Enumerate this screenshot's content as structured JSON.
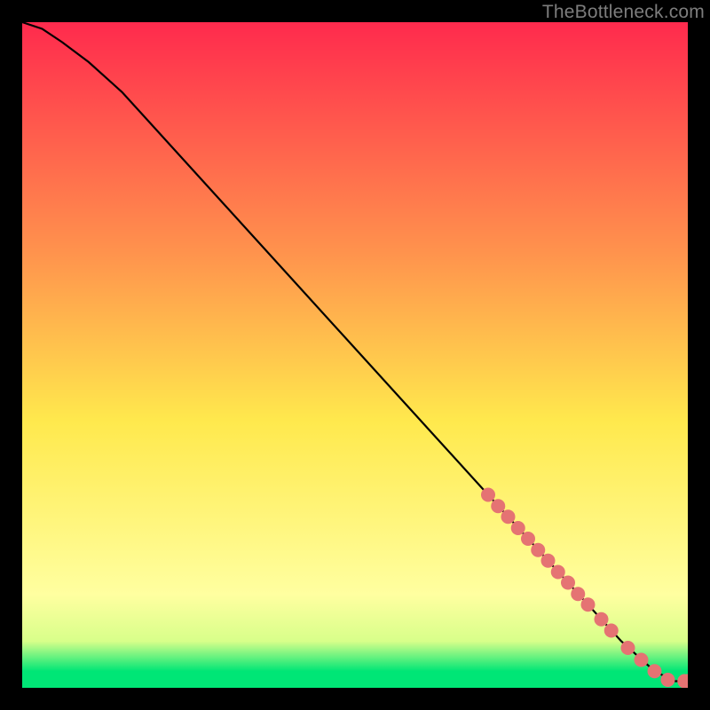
{
  "watermark": "TheBottleneck.com",
  "colors": {
    "frame": "#000000",
    "curve": "#000000",
    "marker": "#e57373",
    "grad_top": "#ff2a4d",
    "grad_mid1": "#ff944d",
    "grad_mid2": "#ffe94d",
    "grad_pale": "#ffffb0",
    "grad_green": "#00e676"
  },
  "chart_data": {
    "type": "line",
    "title": "",
    "xlabel": "",
    "ylabel": "",
    "xlim": [
      0,
      100
    ],
    "ylim": [
      0,
      100
    ],
    "series": [
      {
        "name": "curve",
        "x": [
          0,
          3,
          6,
          10,
          15,
          20,
          30,
          40,
          50,
          60,
          70,
          80,
          90,
          95,
          98,
          100
        ],
        "y": [
          100,
          99,
          97,
          94,
          89.5,
          84,
          73,
          62,
          51,
          40,
          29,
          18,
          7,
          2.5,
          1.0,
          1.0
        ]
      }
    ],
    "markers": {
      "name": "highlight-points",
      "color": "#e57373",
      "radius_px": 8,
      "points": [
        {
          "x": 70.0,
          "y": 29.0
        },
        {
          "x": 71.5,
          "y": 27.3
        },
        {
          "x": 73.0,
          "y": 25.7
        },
        {
          "x": 74.5,
          "y": 24.0
        },
        {
          "x": 76.0,
          "y": 22.4
        },
        {
          "x": 77.5,
          "y": 20.7
        },
        {
          "x": 79.0,
          "y": 19.1
        },
        {
          "x": 80.5,
          "y": 17.4
        },
        {
          "x": 82.0,
          "y": 15.8
        },
        {
          "x": 83.5,
          "y": 14.1
        },
        {
          "x": 85.0,
          "y": 12.5
        },
        {
          "x": 87.0,
          "y": 10.3
        },
        {
          "x": 88.5,
          "y": 8.6
        },
        {
          "x": 91.0,
          "y": 6.0
        },
        {
          "x": 93.0,
          "y": 4.2
        },
        {
          "x": 95.0,
          "y": 2.5
        },
        {
          "x": 97.0,
          "y": 1.2
        },
        {
          "x": 99.5,
          "y": 1.0
        },
        {
          "x": 100.0,
          "y": 1.0
        }
      ]
    },
    "background_gradient": {
      "type": "vertical",
      "stops": [
        {
          "pos": 0.0,
          "color": "#ff2a4d"
        },
        {
          "pos": 0.35,
          "color": "#ff944d"
        },
        {
          "pos": 0.6,
          "color": "#ffe94d"
        },
        {
          "pos": 0.86,
          "color": "#ffffa0"
        },
        {
          "pos": 0.93,
          "color": "#d8ff8a"
        },
        {
          "pos": 0.975,
          "color": "#00e676"
        },
        {
          "pos": 1.0,
          "color": "#00e676"
        }
      ]
    }
  }
}
